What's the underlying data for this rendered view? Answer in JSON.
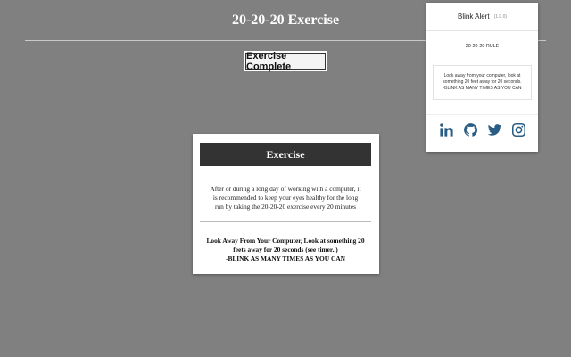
{
  "page": {
    "title": "20-20-20 Exercise",
    "complete_button": "Exercise Complete"
  },
  "card": {
    "heading": "Exercise",
    "description": "After or during a long day of working with a computer, it is recommended to keep your eyes healthy for the long run by taking the 20-20-20 exercise every 20 minutes",
    "instruction_line1": "Look Away From Your Computer, Look at something 20 feets away for 20 seconds (see timer..)",
    "instruction_line2": "-BLINK AS MANY TIMES AS YOU CAN"
  },
  "popup": {
    "app_name": "Blink Alert",
    "version": "(1.0.0)",
    "rule_title": "20-20-20 RULE",
    "rule_text_line1": "Look away from your computer, look at something 20 feet away for 20 seconds.",
    "rule_text_line2": "-BLINK AS MANY TIMES AS YOU CAN",
    "social": [
      {
        "icon": "linkedin-icon"
      },
      {
        "icon": "github-icon"
      },
      {
        "icon": "twitter-icon"
      },
      {
        "icon": "instagram-icon"
      }
    ]
  },
  "colors": {
    "background": "#808080",
    "card_header": "#333333",
    "social_icon": "#2a5d84"
  }
}
